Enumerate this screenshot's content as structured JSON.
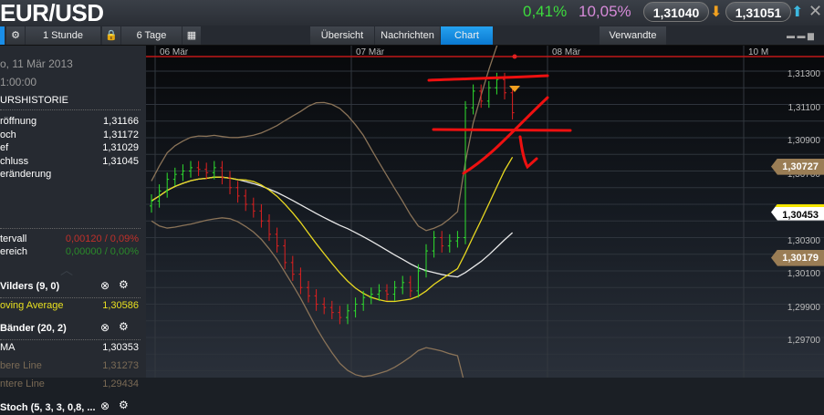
{
  "header": {
    "title": "EUR/USD",
    "change_pct": "0,41%",
    "vol_pct": "10,05%",
    "sell": "1,31040",
    "buy": "1,31051"
  },
  "toolbar": {
    "interval": "1 Stunde",
    "range": "6 Tage",
    "tabs": [
      {
        "label": "Übersicht"
      },
      {
        "label": "Nachrichten"
      },
      {
        "label": "Chart"
      }
    ],
    "related": "Verwandte"
  },
  "panel": {
    "date": "o, 11 Mär 2013",
    "time": "1:00:00",
    "section": "URSHISTORIE",
    "rows": [
      {
        "label": "röffnung",
        "value": "1,31166"
      },
      {
        "label": "och",
        "value": "1,31172"
      },
      {
        "label": "ef",
        "value": "1,31029"
      },
      {
        "label": "chluss",
        "value": "1,31045"
      },
      {
        "label": "eränderung",
        "value": ""
      }
    ],
    "interval": {
      "label": "tervall",
      "value": "0,00120 / 0,09%"
    },
    "range": {
      "label": "ereich",
      "value": "0,00000 / 0,00%"
    },
    "ind1": {
      "title": "Vilders (9, 0)",
      "label": "oving Average",
      "value": "1,30586"
    },
    "ind2": {
      "title": " Bänder (20, 2)",
      "ma": "MA",
      "ma_value": "1,30353",
      "upper": "bere Line",
      "upper_value": "1,31273",
      "lower": "ntere Line",
      "lower_value": "1,29434"
    },
    "ind3": {
      "title": " Stoch (5, 3, 3, 0,8, ..."
    }
  },
  "chart_data": {
    "type": "candlestick",
    "dates": [
      "06 Mär",
      "07 Mär",
      "08 Mär",
      "10 M"
    ],
    "y_ticks": [
      "1,31300",
      "1,31100",
      "1,30900",
      "1,30700",
      "1,30300",
      "1,30100",
      "1,29900",
      "1,29700"
    ],
    "ylim": [
      1.2955,
      1.3145
    ],
    "tags": [
      {
        "value": "1,30727",
        "color": "#9a7d55"
      },
      {
        "value": "1,30453",
        "color": "#ffffff"
      },
      {
        "value": "1,30179",
        "color": "#9a7d55"
      }
    ],
    "close": [
      1.3052,
      1.3058,
      1.3065,
      1.3068,
      1.307,
      1.3072,
      1.3071,
      1.3069,
      1.3072,
      1.3066,
      1.306,
      1.3055,
      1.305,
      1.3046,
      1.304,
      1.3032,
      1.3025,
      1.3015,
      1.3008,
      1.3,
      1.2995,
      1.299,
      1.2988,
      1.2985,
      1.2982,
      1.2986,
      1.299,
      1.2994,
      1.2996,
      1.2998,
      1.2996,
      1.3,
      1.3003,
      1.2998,
      1.301,
      1.3022,
      1.303,
      1.3025,
      1.3028,
      1.303,
      1.3108,
      1.3118,
      1.3112,
      1.312,
      1.3125,
      1.3117,
      1.3105
    ]
  }
}
